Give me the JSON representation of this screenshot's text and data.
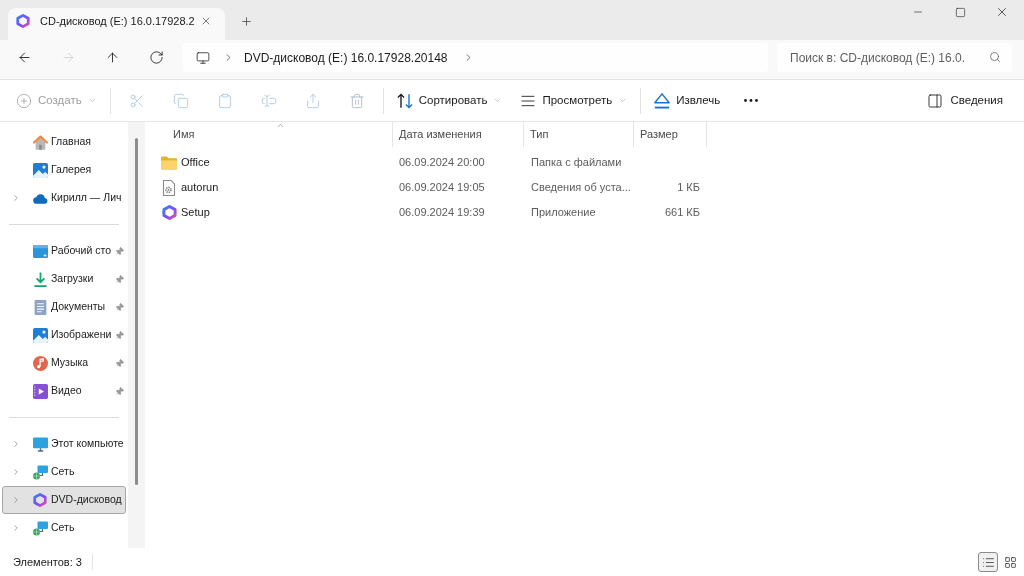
{
  "tabs": [
    {
      "title": "CD-дисковод (E:) 16.0.17928.2",
      "selected": true
    }
  ],
  "navigation": [
    {
      "kind": "back",
      "disabled": false
    },
    {
      "kind": "forward",
      "disabled": true
    },
    {
      "kind": "up",
      "disabled": false
    },
    {
      "kind": "refresh",
      "disabled": false
    }
  ],
  "address_bar": {
    "segments": [
      "DVD-дисковод (E:) 16.0.17928.20148"
    ]
  },
  "search": {
    "placeholder": "Поиск в: CD-дисковод (E:) 16.0."
  },
  "toolbar": {
    "groups": [
      [
        {
          "kind": "create",
          "label": "Создать",
          "disabled": true
        }
      ],
      [
        {
          "kind": "cut",
          "disabled": true
        },
        {
          "kind": "copy",
          "disabled": true
        },
        {
          "kind": "paste",
          "disabled": true
        },
        {
          "kind": "rename",
          "disabled": true
        },
        {
          "kind": "share",
          "disabled": true
        },
        {
          "kind": "delete",
          "disabled": true
        }
      ],
      [
        {
          "kind": "sort",
          "label": "Сортировать",
          "disabled": false
        },
        {
          "kind": "view",
          "label": "Просмотреть",
          "disabled": false
        }
      ],
      [
        {
          "kind": "eject",
          "label": "Извлечь",
          "disabled": false
        },
        {
          "kind": "more",
          "disabled": false
        }
      ]
    ],
    "details": {
      "label": "Сведения"
    }
  },
  "sidebar": {
    "sections": [
      {
        "items": [
          {
            "kind": "home",
            "label": "Главная",
            "expandable": false,
            "pinned": false,
            "selected": false
          },
          {
            "kind": "gallery",
            "label": "Галерея",
            "expandable": false,
            "pinned": false,
            "selected": false
          },
          {
            "kind": "cloud",
            "label": "Кирилл — Лич",
            "expandable": true,
            "pinned": false,
            "selected": false
          }
        ]
      },
      {
        "items": [
          {
            "kind": "desktop",
            "label": "Рабочий сто",
            "expandable": false,
            "pinned": true,
            "selected": false
          },
          {
            "kind": "downloads",
            "label": "Загрузки",
            "expandable": false,
            "pinned": true,
            "selected": false
          },
          {
            "kind": "documents",
            "label": "Документы",
            "expandable": false,
            "pinned": true,
            "selected": false
          },
          {
            "kind": "pictures",
            "label": "Изображени",
            "expandable": false,
            "pinned": true,
            "selected": false
          },
          {
            "kind": "music",
            "label": "Музыка",
            "expandable": false,
            "pinned": true,
            "selected": false
          },
          {
            "kind": "videos",
            "label": "Видео",
            "expandable": false,
            "pinned": true,
            "selected": false
          }
        ]
      },
      {
        "items": [
          {
            "kind": "computer",
            "label": "Этот компьюте",
            "expandable": true,
            "pinned": false,
            "selected": false
          },
          {
            "kind": "network",
            "label": "Сеть",
            "expandable": true,
            "pinned": false,
            "selected": false
          },
          {
            "kind": "drive",
            "label": "DVD-дисковод",
            "expandable": true,
            "pinned": false,
            "selected": true
          },
          {
            "kind": "network",
            "label": "Сеть",
            "expandable": true,
            "pinned": false,
            "selected": false
          }
        ]
      }
    ]
  },
  "table": {
    "columns": [
      {
        "label": "Имя",
        "sorted": true
      },
      {
        "label": "Дата изменения",
        "sorted": false
      },
      {
        "label": "Тип",
        "sorted": false
      },
      {
        "label": "Размер",
        "sorted": false
      }
    ],
    "rows": [
      {
        "kind": "folder",
        "name": "Office",
        "modified": "06.09.2024 20:00",
        "type": "Папка с файлами"
      },
      {
        "kind": "settings-file",
        "name": "autorun",
        "modified": "06.09.2024 19:05",
        "type": "Сведения об уста...",
        "size": "1 КБ"
      },
      {
        "kind": "app",
        "name": "Setup",
        "modified": "06.09.2024 19:39",
        "type": "Приложение",
        "size": "661 КБ"
      }
    ]
  },
  "status_bar": {
    "text": "Элементов: 3",
    "views": [
      {
        "kind": "details",
        "selected": true
      },
      {
        "kind": "tiles",
        "selected": false
      }
    ]
  }
}
